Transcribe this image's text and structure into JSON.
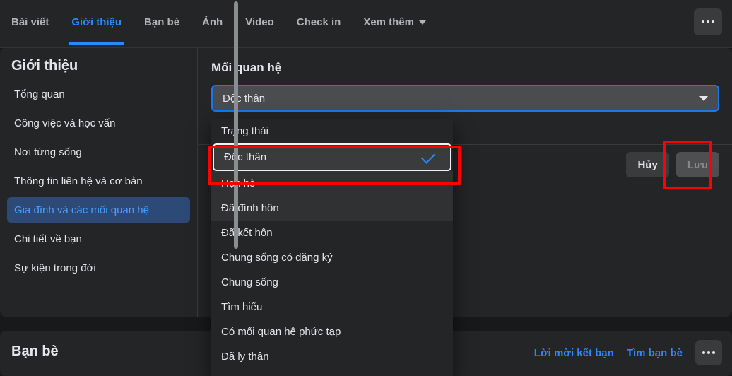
{
  "tabbar": {
    "tabs": [
      {
        "label": "Bài viết",
        "active": false
      },
      {
        "label": "Giới thiệu",
        "active": true
      },
      {
        "label": "Bạn bè",
        "active": false
      },
      {
        "label": "Ảnh",
        "active": false
      },
      {
        "label": "Video",
        "active": false
      },
      {
        "label": "Check in",
        "active": false
      },
      {
        "label": "Xem thêm",
        "active": false,
        "caret": true
      }
    ],
    "more_button": "options-icon"
  },
  "sidebar": {
    "title": "Giới thiệu",
    "items": [
      {
        "label": "Tổng quan",
        "active": false
      },
      {
        "label": "Công việc và học vấn",
        "active": false
      },
      {
        "label": "Nơi từng sống",
        "active": false
      },
      {
        "label": "Thông tin liên hệ và cơ bản",
        "active": false
      },
      {
        "label": "Gia đình và các mối quan hệ",
        "active": true
      },
      {
        "label": "Chi tiết về bạn",
        "active": false
      },
      {
        "label": "Sự kiện trong đời",
        "active": false
      }
    ]
  },
  "main": {
    "section_title": "Mối quan hệ",
    "select_value": "Độc thân",
    "cancel_label": "Hủy",
    "save_label": "Lưu",
    "save_disabled": true
  },
  "dropdown": {
    "items": [
      {
        "label": "Trạng thái",
        "type": "header",
        "selected": false,
        "hover": false
      },
      {
        "label": "Độc thân",
        "type": "option",
        "selected": true,
        "hover": false
      },
      {
        "label": "Hẹn hò",
        "type": "option",
        "selected": false,
        "hover": true
      },
      {
        "label": "Đã đính hôn",
        "type": "option",
        "selected": false,
        "hover": true
      },
      {
        "label": "Đã kết hôn",
        "type": "option",
        "selected": false,
        "hover": false
      },
      {
        "label": "Chung sống có đăng ký",
        "type": "option",
        "selected": false,
        "hover": false
      },
      {
        "label": "Chung sống",
        "type": "option",
        "selected": false,
        "hover": false
      },
      {
        "label": "Tìm hiểu",
        "type": "option",
        "selected": false,
        "hover": false
      },
      {
        "label": "Có mối quan hệ phức tạp",
        "type": "option",
        "selected": false,
        "hover": false
      },
      {
        "label": "Đã ly thân",
        "type": "option",
        "selected": false,
        "hover": false
      }
    ]
  },
  "friends": {
    "title": "Bạn bè",
    "requests_label": "Lời mời kết bạn",
    "find_label": "Tìm bạn bè",
    "more_button": "options-icon"
  },
  "annotations": [
    {
      "name": "highlight-selected-option",
      "color": "#ff0000"
    },
    {
      "name": "highlight-save-button",
      "color": "#ff0000"
    }
  ],
  "colors": {
    "accent_blue": "#2d88ff",
    "focus_blue": "#1877f2",
    "annotation_red": "#ff0000",
    "card_bg": "#242526",
    "page_bg": "#18191a"
  }
}
